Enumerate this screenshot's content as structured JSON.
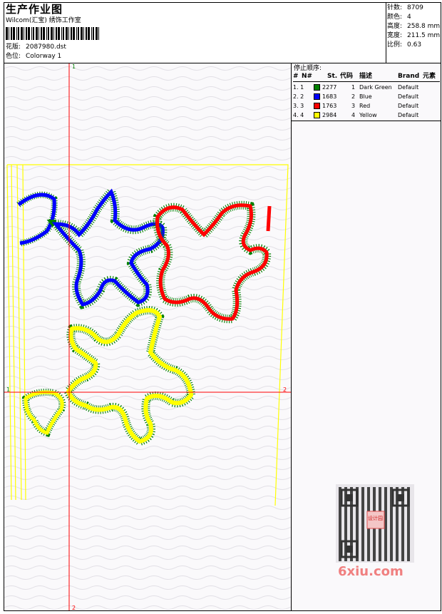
{
  "header": {
    "title": "生产作业图",
    "company": "Wilcom(汇宝) 绣饰工作室",
    "design_label": "花版:",
    "design_value": "2087980.dst",
    "colorway_label": "色位:",
    "colorway_value": "Colorway 1"
  },
  "stats": [
    {
      "label": "针数:",
      "value": "8709"
    },
    {
      "label": "颜色:",
      "value": "4"
    },
    {
      "label": "高度:",
      "value": "258.8 mm"
    },
    {
      "label": "宽度:",
      "value": "211.5 mm"
    },
    {
      "label": "比例:",
      "value": "0.63"
    }
  ],
  "stop_sequence": {
    "title": "停止顺序:",
    "columns": [
      "#",
      "N#",
      "St.",
      "代码",
      "描述",
      "Brand",
      "元素"
    ],
    "rows": [
      {
        "index": "1. 1",
        "color": "#008000",
        "stitches": "2277",
        "code": "1",
        "description": "Dark Green",
        "brand": "Default"
      },
      {
        "index": "2. 2",
        "color": "#0000ff",
        "stitches": "1683",
        "code": "2",
        "description": "Blue",
        "brand": "Default"
      },
      {
        "index": "3. 3",
        "color": "#ff0000",
        "stitches": "1763",
        "code": "3",
        "description": "Red",
        "brand": "Default"
      },
      {
        "index": "4. 4",
        "color": "#ffff00",
        "stitches": "2984",
        "code": "4",
        "description": "Yellow",
        "brand": "Default"
      }
    ]
  },
  "guides": {
    "top": "1",
    "bottom": "2",
    "left": "1",
    "right": "2"
  },
  "watermark": {
    "text": "6xiu.com",
    "seal": "设计园"
  }
}
